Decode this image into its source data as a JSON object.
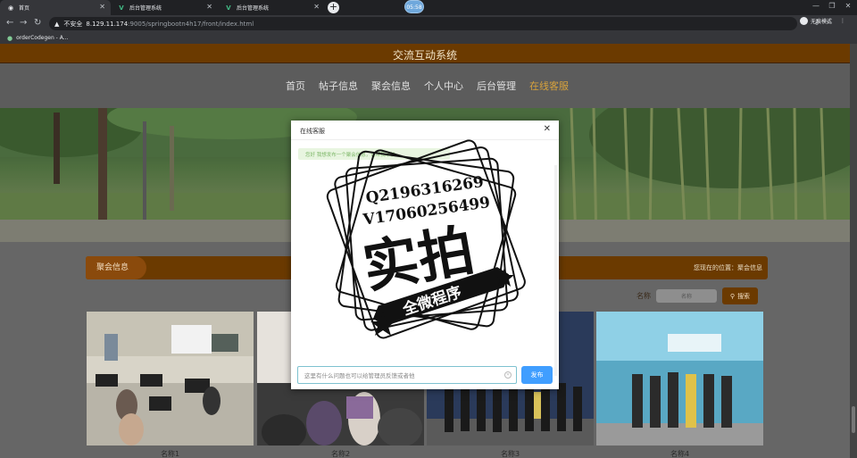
{
  "browser": {
    "tabs": [
      {
        "title": "首页",
        "icon": "globe-icon"
      },
      {
        "title": "后台管理系统",
        "icon": "vue-icon"
      },
      {
        "title": "后台管理系统",
        "icon": "vue-icon"
      }
    ],
    "timer": "05:58",
    "security": "不安全",
    "url_host": "8.129.11.174",
    "url_path": ":9005/springbootn4h17/front/index.html",
    "profile_label": "无痕模式",
    "bookmark": "orderCodegen - A..."
  },
  "site": {
    "title": "交流互动系统",
    "nav": [
      "首页",
      "帖子信息",
      "聚会信息",
      "个人中心",
      "后台管理",
      "在线客服"
    ],
    "active_nav": "在线客服"
  },
  "section": {
    "title": "聚会信息",
    "breadcrumb": "您现在的位置：聚会信息",
    "search_label": "名称",
    "search_placeholder": "名称",
    "search_button": "搜索"
  },
  "cards": [
    {
      "caption": "名称1"
    },
    {
      "caption": "名称2"
    },
    {
      "caption": "名称3"
    },
    {
      "caption": "名称4"
    }
  ],
  "modal": {
    "title": "在线客服",
    "greeting": "您好 我想发布一个聚会信息，请帮我审核",
    "input_placeholder": "这里有什么问题也可以给管理员反馈或者他",
    "send_label": "发布"
  },
  "watermark": {
    "line1": "Q2196316269",
    "line2": "V17060256499",
    "big": "实拍",
    "ribbon": "全微程序"
  },
  "colors": {
    "header_brown": "#6b3a00",
    "active_nav": "#d7a23c",
    "send_button": "#409eff"
  }
}
